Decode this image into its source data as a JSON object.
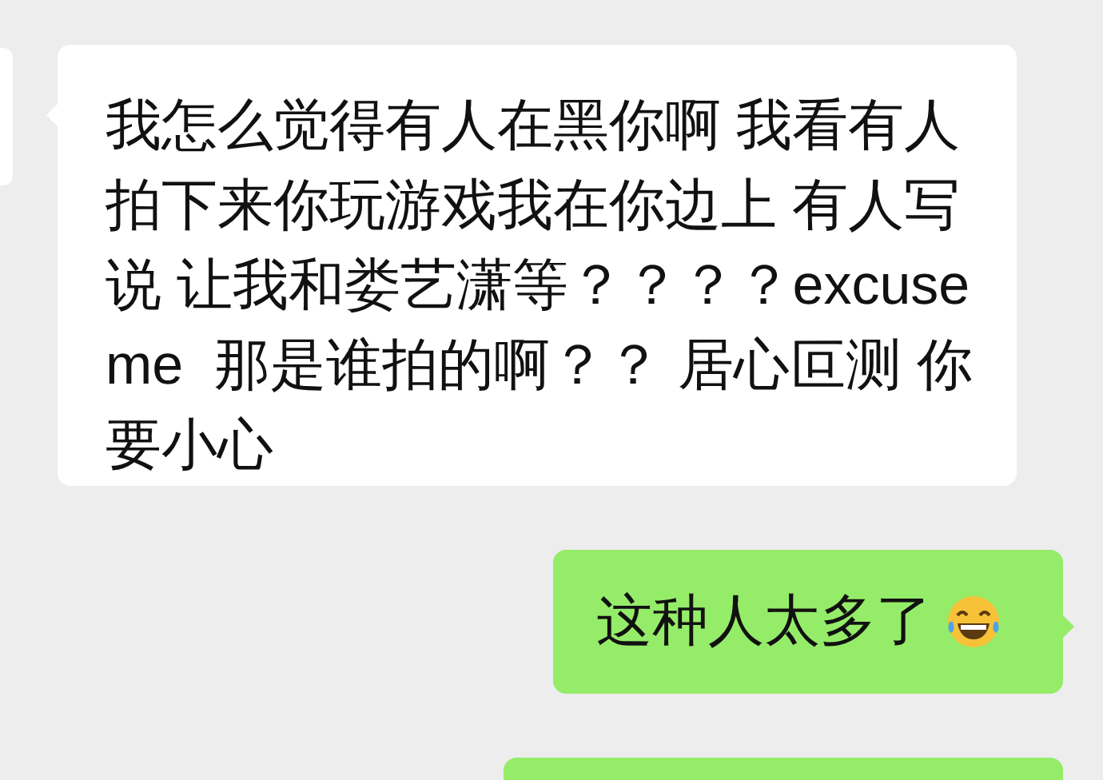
{
  "messages": [
    {
      "kind": "received",
      "text": "我怎么觉得有人在黑你啊 我看有人拍下来你玩游戏我在你边上 有人写说 让我和娄艺潇等？？？？excuse me  那是谁拍的啊？？ 居心叵测 你要小心",
      "has_emoji": false,
      "cut": false
    },
    {
      "kind": "sent",
      "text": "这种人太多了",
      "has_emoji": true,
      "cut": false
    },
    {
      "kind": "sent",
      "has_emoji": false,
      "cut": true
    }
  ]
}
